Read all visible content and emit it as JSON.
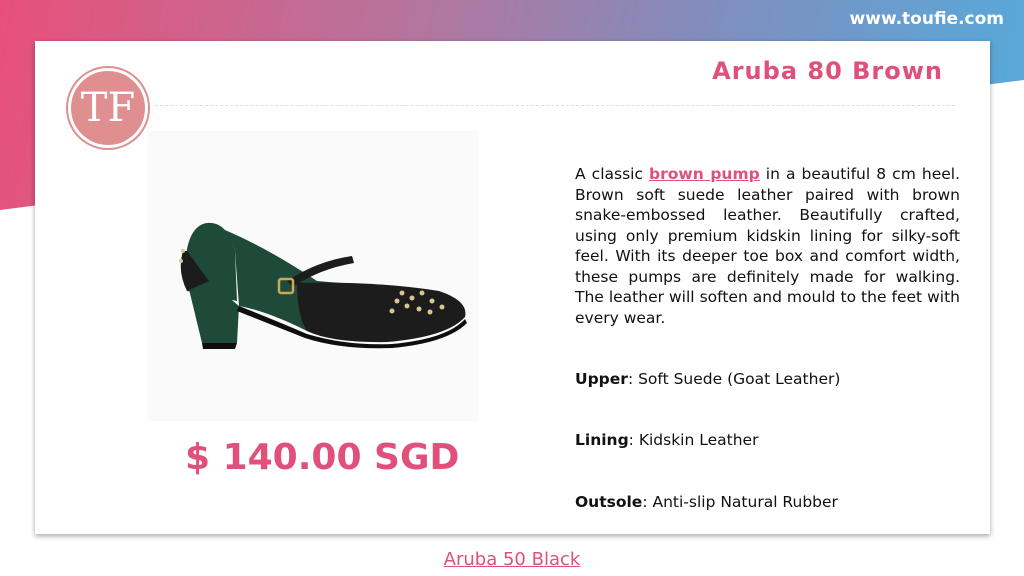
{
  "header": {
    "site_url": "www.toufie.com"
  },
  "logo": {
    "letters": "TF"
  },
  "product": {
    "title": "Aruba 80 Brown",
    "price": "$ 140.00 SGD",
    "description": {
      "prefix": "A classic ",
      "highlight": "brown pump",
      "body": " in a beautiful 8 cm heel. Brown soft suede leather paired with brown snake-embossed leather. Beautifully crafted, using only premium kidskin lining for silky-soft feel. With its deeper toe box and comfort width, these pumps are definitely made for walking. The leather will soften and mould to the feet with every wear."
    },
    "specs": [
      {
        "label": "Upper",
        "value": ": Soft Suede (Goat Leather)"
      },
      {
        "label": "Lining",
        "value": ": Kidskin Leather"
      },
      {
        "label": "Outsole",
        "value": ": Anti-slip Natural Rubber"
      }
    ]
  },
  "footer": {
    "link_label": "Aruba 50 Black"
  },
  "colors": {
    "accent": "#e0507a",
    "logo": "#df8f8f",
    "shoe_suede": "#1f4a3a",
    "shoe_leather": "#1c1c1c"
  }
}
